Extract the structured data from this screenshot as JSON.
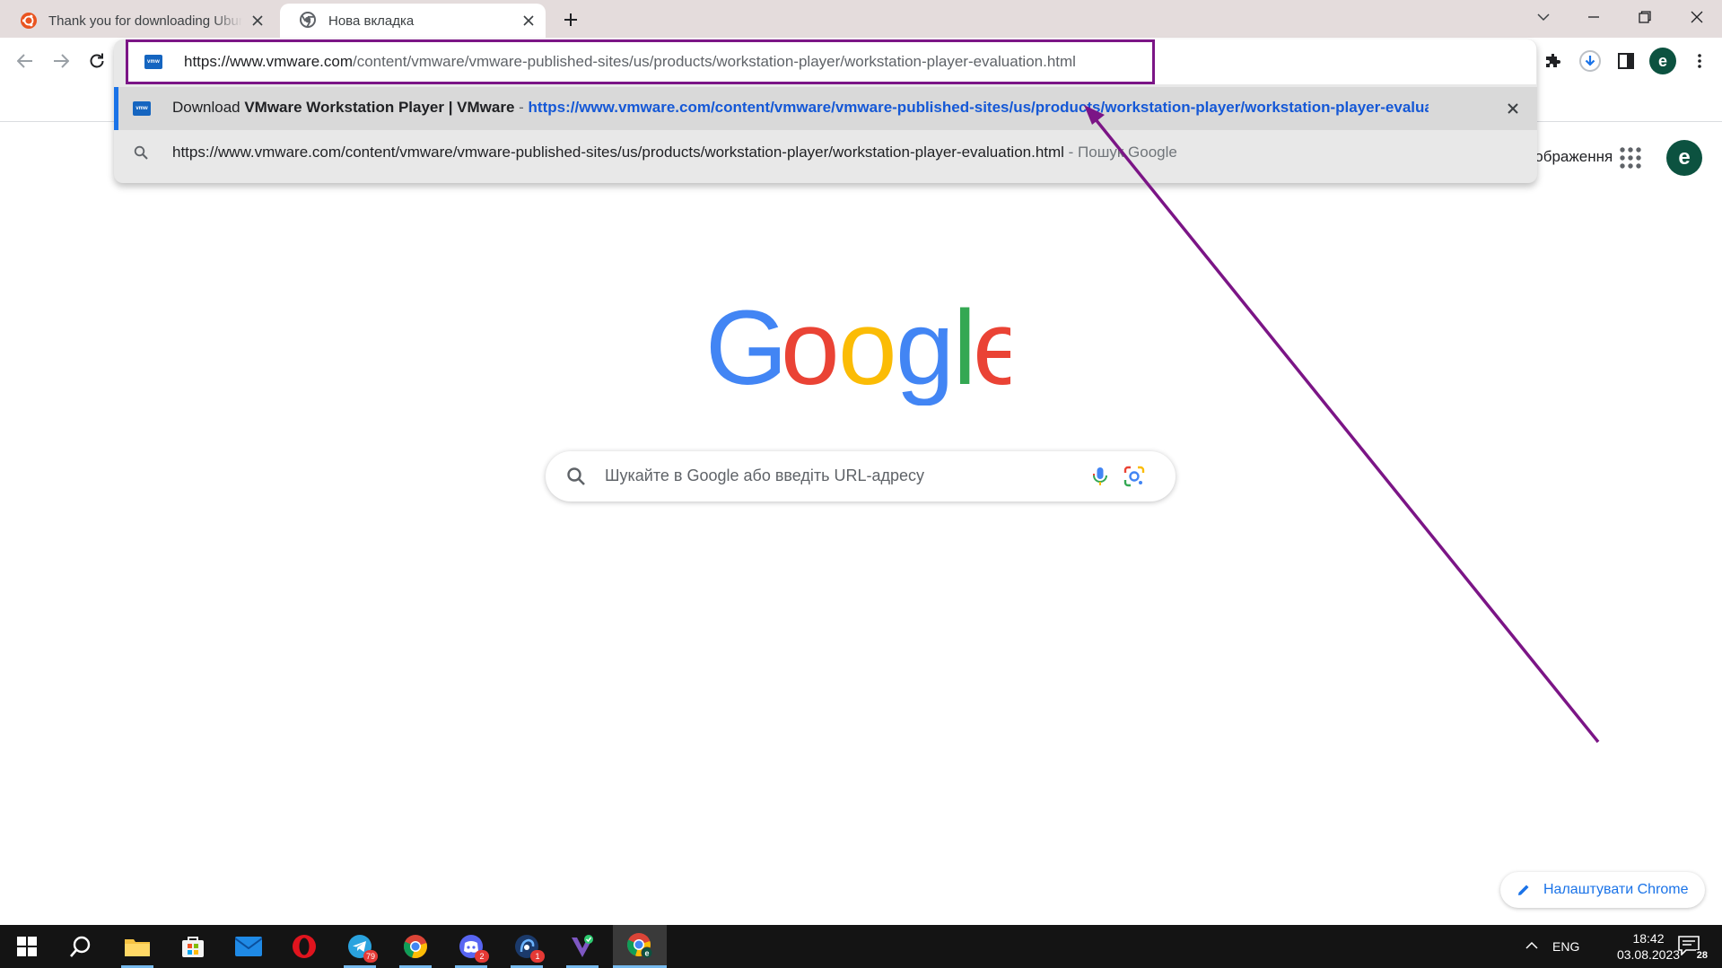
{
  "tabs": [
    {
      "title": "Thank you for downloading Ubuntu",
      "active": false
    },
    {
      "title": "Нова вкладка",
      "active": true
    }
  ],
  "omnibox": {
    "url_host": "https://www.vmware.com",
    "url_path": "/content/vmware/vmware-published-sites/us/products/workstation-player/workstation-player-evaluation.html",
    "favicon_label": "vmw"
  },
  "suggestions": [
    {
      "prefix": "Download ",
      "title_bold": "VMware Workstation Player | VMware",
      "separator": " - ",
      "url": "https://www.vmware.com/content/vmware/vmware-published-sites/us/products/workstation-player/workstation-player-evaluation.html"
    },
    {
      "text": "https://www.vmware.com/content/vmware/vmware-published-sites/us/products/workstation-player/workstation-player-evaluation.html",
      "separator": " - ",
      "suffix": "Пошук Google"
    }
  ],
  "profile_initial": "e",
  "page": {
    "images_link": "Зображення",
    "search_placeholder": "Шукайте в Google або введіть URL-адресу",
    "customize_label": "Налаштувати Chrome",
    "logo_letters": [
      "G",
      "o",
      "o",
      "g",
      "l",
      "e"
    ]
  },
  "taskbar": {
    "apps": [
      "start",
      "search",
      "file-explorer",
      "microsoft-store",
      "mail",
      "opera",
      "telegram",
      "chrome",
      "discord",
      "phone-app",
      "vpn",
      "chrome-profile"
    ],
    "badges": {
      "telegram": "79",
      "discord": "2",
      "phone-app": "1"
    },
    "language": "ENG",
    "time": "18:42",
    "date": "03.08.2023",
    "notifications": "28"
  },
  "colors": {
    "annotation": "#7b1586",
    "google_blue": "#4285f4",
    "google_red": "#ea4335",
    "google_yellow": "#fbbc05",
    "google_green": "#34a853",
    "profile_bg": "#0c5240",
    "link_blue": "#1558d6"
  }
}
